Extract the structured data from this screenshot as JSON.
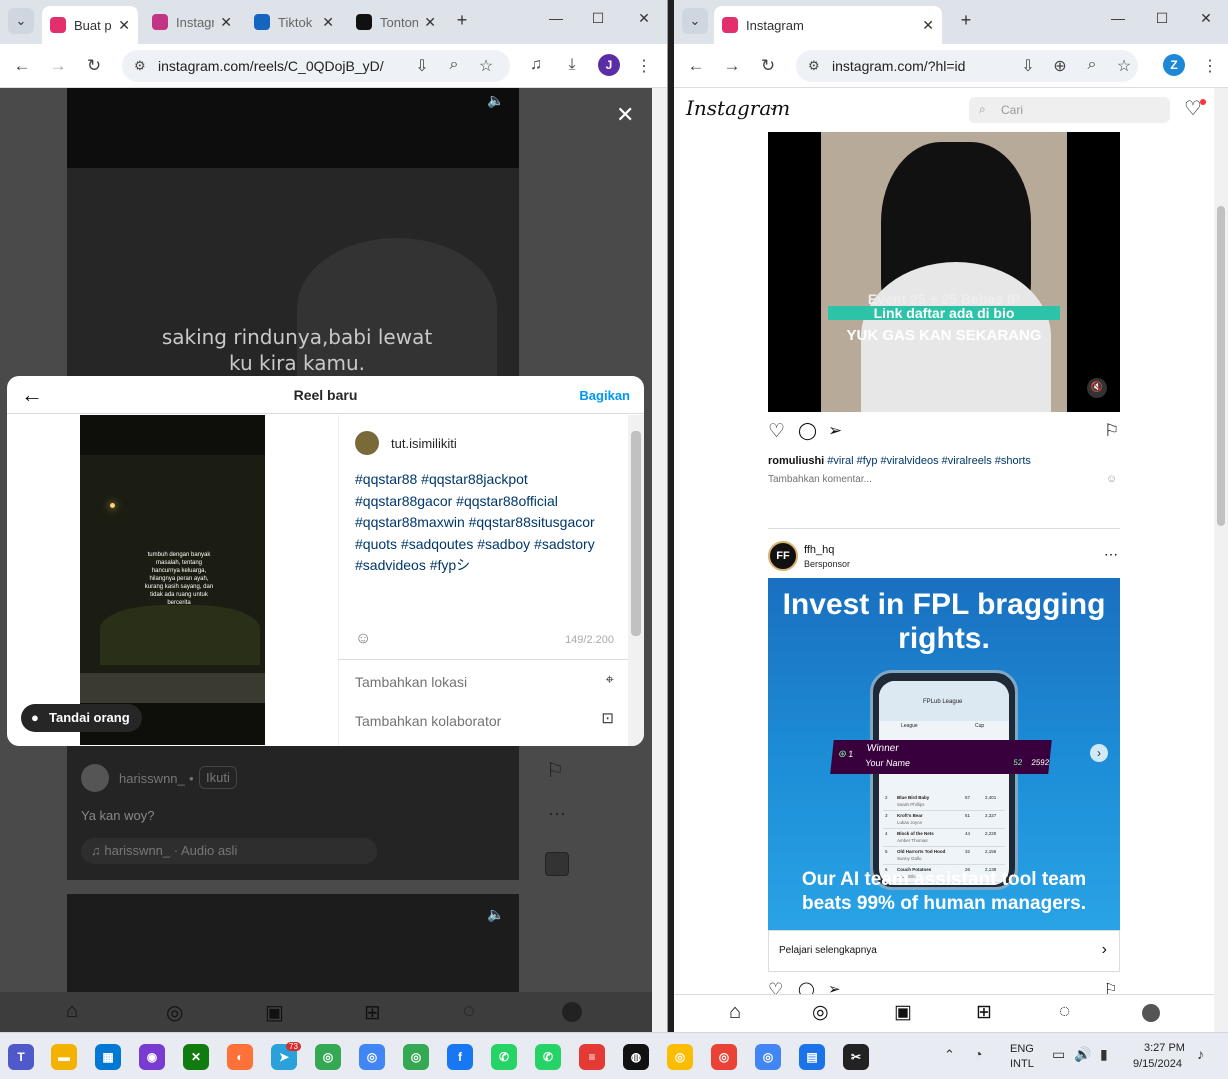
{
  "left": {
    "tabs": [
      {
        "label": "Buat postingan",
        "color": "#e1306c"
      },
      {
        "label": "Instagram",
        "color": "#c13584"
      },
      {
        "label": "Tiktok Downloader",
        "color": "#1565c0"
      },
      {
        "label": "Tonton",
        "color": "#111111"
      }
    ],
    "url": "instagram.com/reels/C_0QDojB_yD/",
    "profile_initial": "J",
    "video_caption": "saking rindunya,babi lewat\nku kira kamu.",
    "modal": {
      "title": "Reel baru",
      "share": "Bagikan",
      "username": "tut.isimilikiti",
      "caption": "#qqstar88 #qqstar88jackpot #qqstar88gacor #qqstar88official #qqstar88maxwin #qqstar88situsgacor #quots #sadqoutes #sadboy #sadstory #sadvideos #fypシ",
      "counter": "149/2.200",
      "add_location": "Tambahkan lokasi",
      "add_collaborator": "Tambahkan kolaborator",
      "tag_people": "Tandai orang",
      "preview_text": "tumbuh dengan banyak masalah, tentang hancurnya keluarga, hilangnya peran ayah, kurang kasih sayang, dan tidak ada ruang untuk bercerita"
    },
    "reel_meta": {
      "user": "harisswnn_",
      "follow": "Ikuti",
      "caption": "Ya kan woy?",
      "audio": "harisswnn_ · Audio asli"
    }
  },
  "right": {
    "tab_label": "Instagram",
    "url": "instagram.com/?hl=id",
    "profile_initial": "Z",
    "logo": "Instagram",
    "search_placeholder": "Cari",
    "post1": {
      "overlay_line1": "Event 25 + 25 Bebas IP",
      "overlay_line2": "Link daftar ada di bio",
      "overlay_line3": "YUK GAS KAN SEKARANG",
      "author": "romuliushi",
      "tags": "#viral #fyp #viralvideos #viralreels #shorts",
      "comment_placeholder": "Tambahkan komentar..."
    },
    "post2": {
      "author": "ffh_hq",
      "sponsored": "Bersponsor",
      "headline": "Invest in FPL bragging rights.",
      "winner": "Winner",
      "your_name": "Your Name",
      "rank": "1",
      "score_a": "52",
      "score_b": "2592",
      "bottom_line1": "Our AI team assistant tool team",
      "bottom_line2": "beats 99% of human managers.",
      "cta": "Pelajari selengkapnya",
      "phone_title": "FPLub League",
      "tab_league": "League",
      "tab_cup": "Cup",
      "table": [
        {
          "rank": "2",
          "name": "Blue Bird Baby",
          "sub": "Sarah Phillips",
          "gw": "57",
          "tot": "2,401"
        },
        {
          "rank": "3",
          "name": "Kroft's Bear",
          "sub": "Lukas Joyce",
          "gw": "51",
          "tot": "2,327"
        },
        {
          "rank": "4",
          "name": "Block of the Nets",
          "sub": "Amber Thomas",
          "gw": "44",
          "tot": "2,220"
        },
        {
          "rank": "5",
          "name": "Old Harrorts Tod Hood",
          "sub": "Sunny Gallo",
          "gw": "32",
          "tot": "2,156"
        },
        {
          "rank": "6",
          "name": "Couch Potatoes",
          "sub": "Mark Ellis",
          "gw": "26",
          "tot": "2,138"
        }
      ]
    }
  },
  "taskbar": {
    "lang1": "ENG",
    "lang2": "INTL",
    "time": "3:27 PM",
    "date": "9/15/2024",
    "telegram_badge": "73"
  },
  "colors": {
    "ig_blue": "#0095f6",
    "hashtag": "#00376b",
    "ad_blue": "#1d8fd8"
  }
}
